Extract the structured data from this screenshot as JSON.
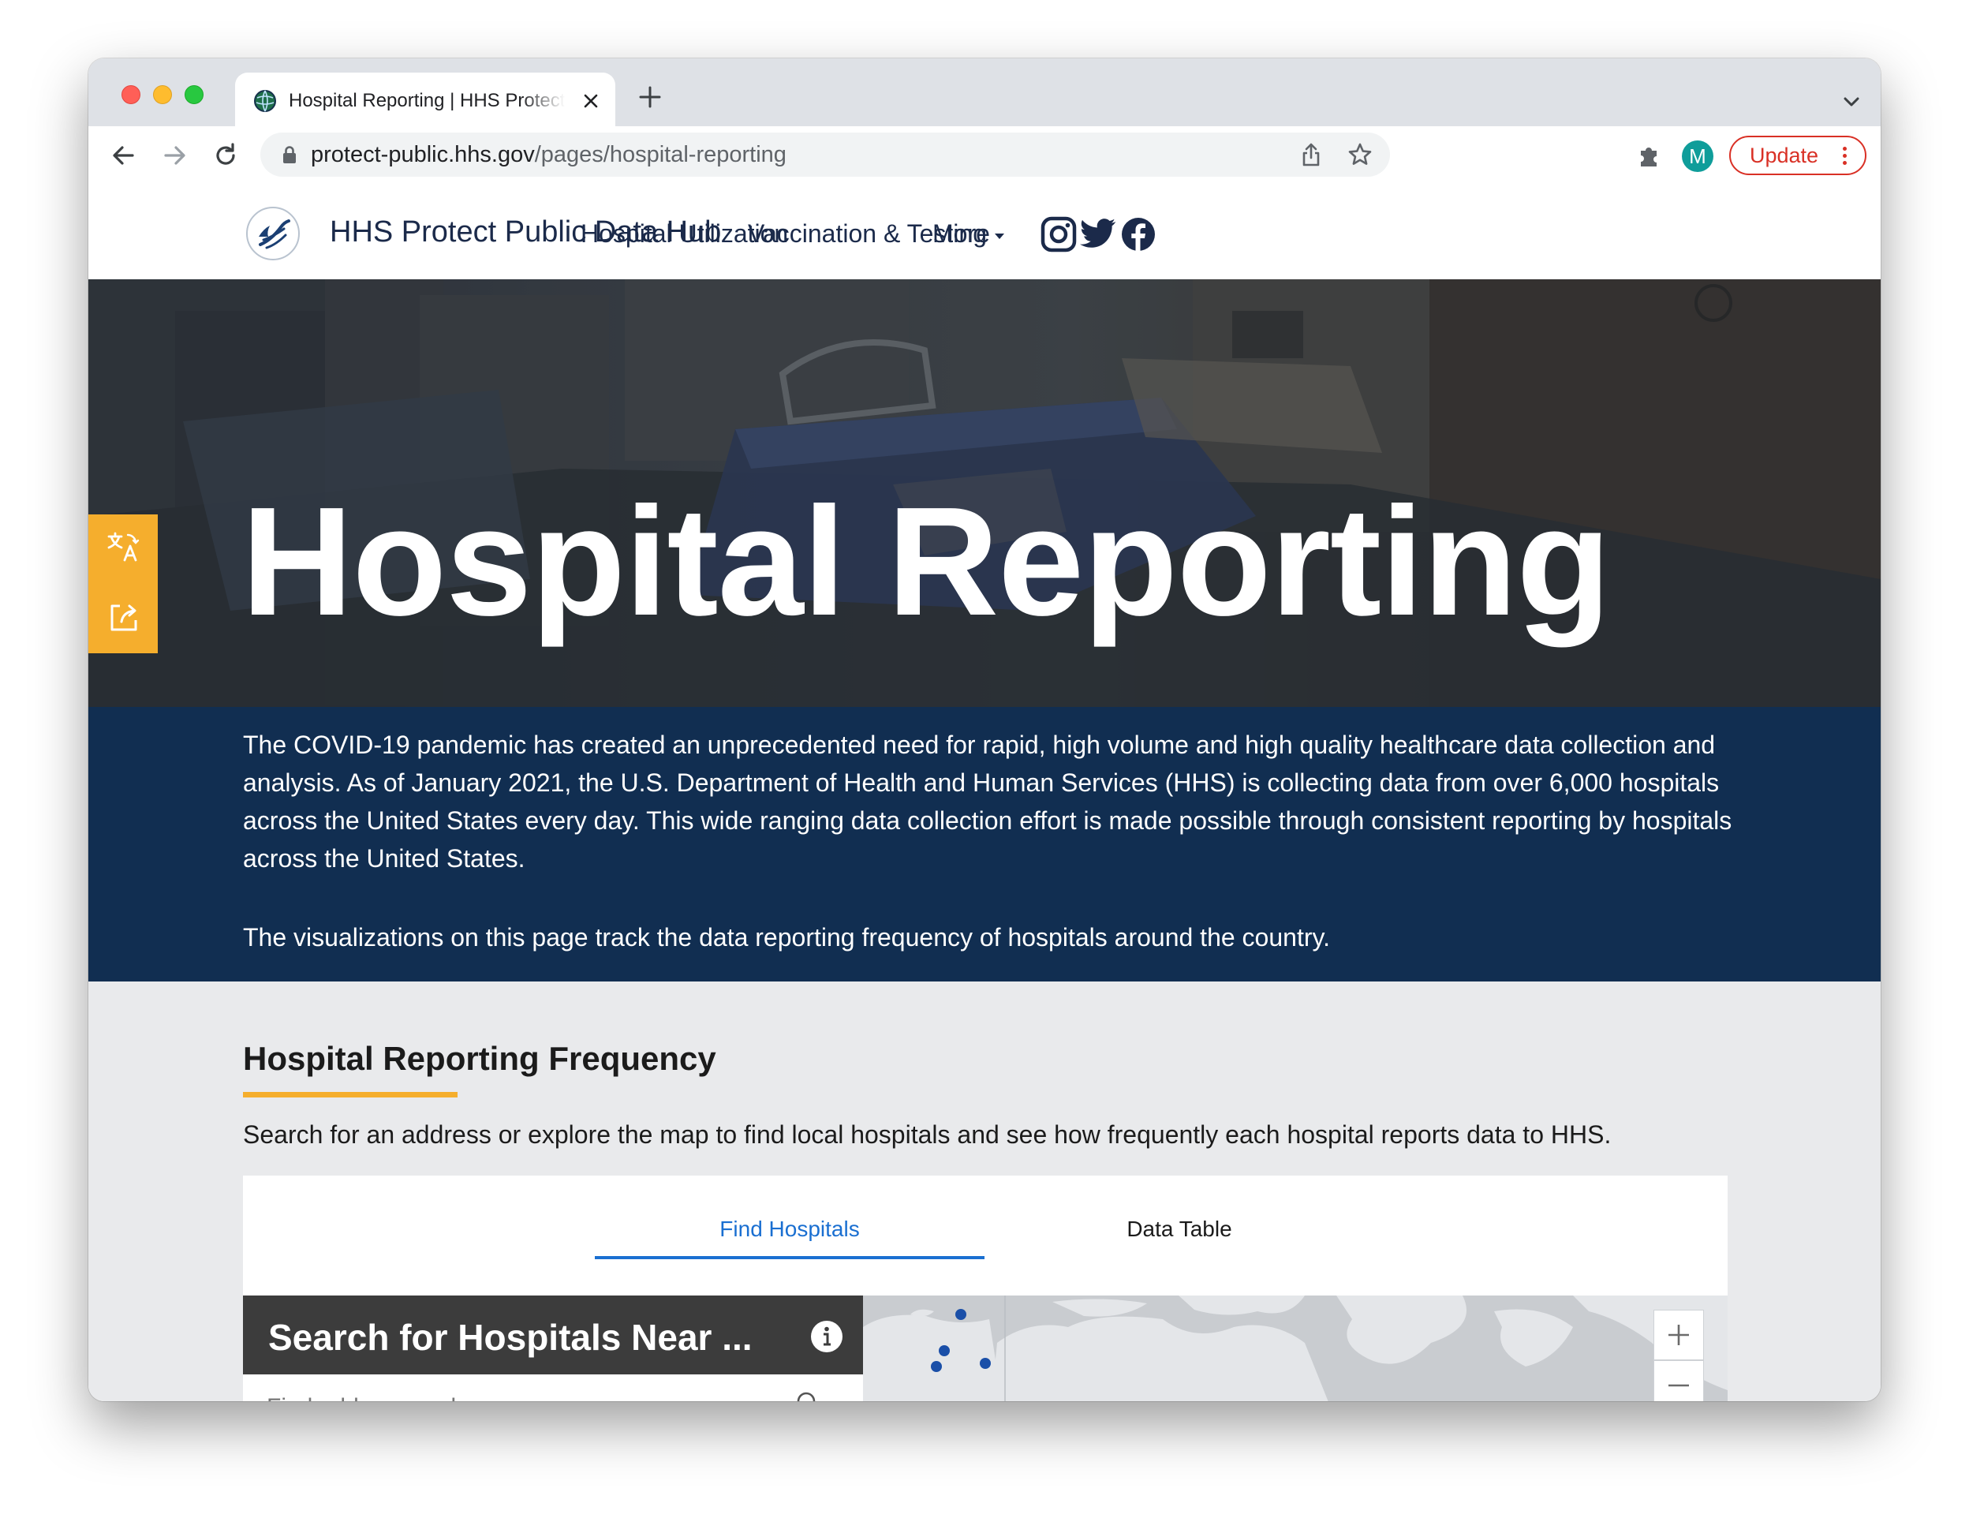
{
  "browser": {
    "tab_title": "Hospital Reporting | HHS Protect Public Data Hub",
    "url_host": "protect-public.hhs.gov",
    "url_path": "/pages/hospital-reporting",
    "profile_initial": "M",
    "update_label": "Update",
    "colors": {
      "update": "#d93025",
      "avatar": "#0f9d9a"
    }
  },
  "site": {
    "title": "HHS Protect Public Data Hub",
    "nav": [
      "Hospital Utilization",
      "Vaccination & Testing",
      "More"
    ],
    "social": [
      "instagram-icon",
      "twitter-icon",
      "facebook-icon"
    ]
  },
  "hero": {
    "title": "Hospital Reporting",
    "side_tools": [
      "translate-icon",
      "share-icon"
    ]
  },
  "intro": {
    "paragraph1": "The COVID-19 pandemic has created an unprecedented need for rapid, high volume and high quality healthcare data collection and analysis. As of January 2021, the U.S. Department of Health and Human Services (HHS) is collecting data from over 6,000 hospitals across the United States every day. This wide ranging data collection effort is made possible through consistent reporting by hospitals across the United States.",
    "paragraph2": "The visualizations on this page track the data reporting frequency of hospitals around the country."
  },
  "frequency": {
    "heading": "Hospital Reporting Frequency",
    "description": "Search for an address or explore the map to find local hospitals and see how frequently each hospital reports data to HHS.",
    "tabs": [
      "Find Hospitals",
      "Data Table"
    ],
    "active_tab": "Find Hospitals",
    "search_title": "Search for Hospitals Near ...",
    "search_placeholder": "Find address or place",
    "colors": {
      "accent": "#f5ae2d",
      "navy": "#112e51",
      "link": "#1a6fd1"
    }
  }
}
